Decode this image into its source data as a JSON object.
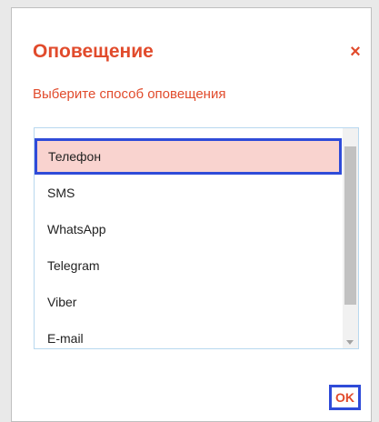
{
  "dialog": {
    "title": "Оповещение",
    "subtitle": "Выберите способ оповещения",
    "close_glyph": "×",
    "ok_label": "OK"
  },
  "options": [
    {
      "label": "Телефон",
      "selected": true
    },
    {
      "label": "SMS",
      "selected": false
    },
    {
      "label": "WhatsApp",
      "selected": false
    },
    {
      "label": "Telegram",
      "selected": false
    },
    {
      "label": "Viber",
      "selected": false
    },
    {
      "label": "E-mail",
      "selected": false
    }
  ],
  "colors": {
    "accent": "#e14b2c",
    "selection_bg": "#f9d3cf",
    "focus_outline": "#2f4bd8"
  }
}
